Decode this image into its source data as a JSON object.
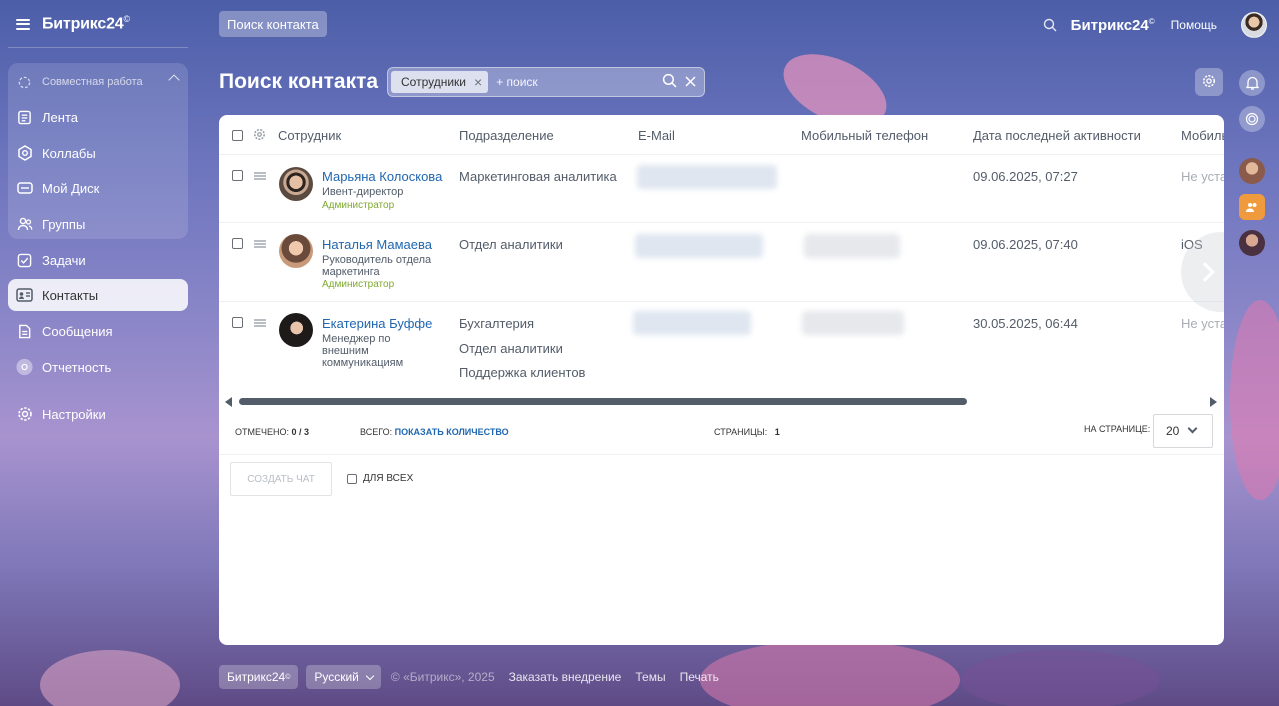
{
  "app": {
    "brand": "Битрикс24",
    "brand_mark": "©",
    "top_button": "Поиск контакта",
    "help": "Помощь"
  },
  "sidebar": {
    "group_label": "Совместная работа",
    "items": [
      {
        "label": "Лента",
        "icon": "feed-icon"
      },
      {
        "label": "Коллабы",
        "icon": "collab-icon"
      },
      {
        "label": "Мой Диск",
        "icon": "disk-icon"
      },
      {
        "label": "Группы",
        "icon": "groups-icon"
      },
      {
        "label": "Задачи",
        "icon": "tasks-icon"
      },
      {
        "label": "Контакты",
        "icon": "contacts-icon"
      },
      {
        "label": "Сообщения",
        "icon": "messages-icon"
      },
      {
        "label": "Отчетность",
        "icon": "reports-icon"
      },
      {
        "label": "Настройки",
        "icon": "gear-icon"
      }
    ]
  },
  "page": {
    "title": "Поиск контакта",
    "filter_chip": "Сотрудники",
    "search_placeholder": "+ поиск"
  },
  "table": {
    "columns": [
      "Сотрудник",
      "Подразделение",
      "E-Mail",
      "Мобильный телефон",
      "Дата последней активности",
      "Мобиль"
    ],
    "rows": [
      {
        "name": "Марьяна Колоскова",
        "position": "Ивент-директор",
        "role": "Администратор",
        "departments": [
          "Маркетинговая аналитика"
        ],
        "activity": "09.06.2025, 07:27",
        "mobile_app": "Не уста"
      },
      {
        "name": "Наталья Мамаева",
        "position": "Руководитель отдела маркетинга",
        "role": "Администратор",
        "departments": [
          "Отдел аналитики"
        ],
        "activity": "09.06.2025, 07:40",
        "mobile_app": "iOS"
      },
      {
        "name": "Екатерина Буффе",
        "position": "Менеджер по внешним коммуникациям",
        "role": "",
        "departments": [
          "Бухгалтерия",
          "Отдел аналитики",
          "Поддержка клиентов"
        ],
        "activity": "30.05.2025, 06:44",
        "mobile_app": "Не уста"
      }
    ]
  },
  "footer": {
    "marked_label": "Отмечено:",
    "marked_value": "0 / 3",
    "total_label": "Всего:",
    "total_link": "Показать количество",
    "pages_label": "Страницы:",
    "pages_value": "1",
    "per_page_label": "На странице:",
    "per_page_value": "20",
    "create_chat": "Создать чат",
    "for_all": "Для всех"
  },
  "bottom": {
    "brand": "Битрикс24",
    "lang": "Русский",
    "copyright": "© «Битрикс», 2025",
    "links": [
      "Заказать внедрение",
      "Темы",
      "Печать"
    ]
  }
}
